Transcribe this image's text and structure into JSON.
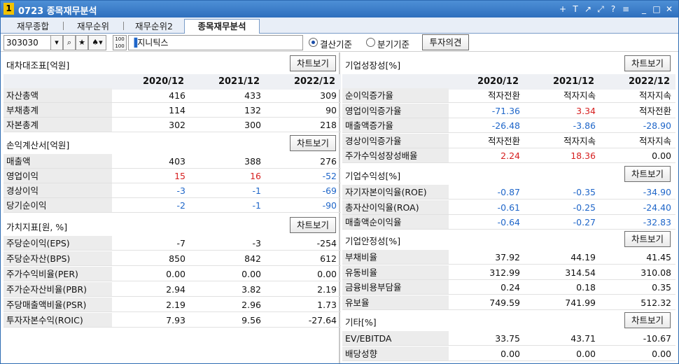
{
  "titlebar": {
    "number": "1",
    "title": "0723 종목재무분석",
    "icons": [
      "plus-icon",
      "text-icon",
      "chart-icon",
      "link-icon",
      "help-icon",
      "menu-icon",
      "minimize-icon",
      "maximize-icon",
      "close-icon"
    ],
    "glyphs": [
      "+",
      "T",
      "↗",
      "⤢",
      "?",
      "≡",
      "_",
      "□",
      "✕"
    ]
  },
  "tabs": [
    "재무종합",
    "재무순위",
    "재무순위2",
    "종목재무분석"
  ],
  "active_tab": "종목재무분석",
  "toolbar": {
    "stock_code": "303030",
    "stock_name": "지니틱스",
    "radio_annual": "결산기준",
    "radio_quarter": "분기기준",
    "selected_radio": "결산기준",
    "opinion_button": "투자의견"
  },
  "chart_button": "차트보기",
  "years": [
    "2020/12",
    "2021/12",
    "2022/12"
  ],
  "left": {
    "balance": {
      "title": "대차대조표[억원]",
      "rows": [
        {
          "label": "자산총액",
          "values": [
            "416",
            "433",
            "309"
          ],
          "colors": [
            "black",
            "black",
            "black"
          ]
        },
        {
          "label": "부채총계",
          "values": [
            "114",
            "132",
            "90"
          ],
          "colors": [
            "black",
            "black",
            "black"
          ]
        },
        {
          "label": "자본총계",
          "values": [
            "302",
            "300",
            "218"
          ],
          "colors": [
            "black",
            "black",
            "black"
          ]
        }
      ]
    },
    "income": {
      "title": "손익계산서[억원]",
      "rows": [
        {
          "label": "매출액",
          "values": [
            "403",
            "388",
            "276"
          ],
          "colors": [
            "black",
            "black",
            "black"
          ]
        },
        {
          "label": "영업이익",
          "values": [
            "15",
            "16",
            "-52"
          ],
          "colors": [
            "red",
            "red",
            "blue"
          ]
        },
        {
          "label": "경상이익",
          "values": [
            "-3",
            "-1",
            "-69"
          ],
          "colors": [
            "blue",
            "blue",
            "blue"
          ]
        },
        {
          "label": "당기순이익",
          "values": [
            "-2",
            "-1",
            "-90"
          ],
          "colors": [
            "blue",
            "blue",
            "blue"
          ]
        }
      ]
    },
    "value": {
      "title": "가치지표[원, %]",
      "rows": [
        {
          "label": "주당순이익(EPS)",
          "values": [
            "-7",
            "-3",
            "-254"
          ],
          "colors": [
            "black",
            "black",
            "black"
          ]
        },
        {
          "label": "주당순자산(BPS)",
          "values": [
            "850",
            "842",
            "612"
          ],
          "colors": [
            "black",
            "black",
            "black"
          ]
        },
        {
          "label": "주가수익비율(PER)",
          "values": [
            "0.00",
            "0.00",
            "0.00"
          ],
          "colors": [
            "black",
            "black",
            "black"
          ]
        },
        {
          "label": "주가순자산비율(PBR)",
          "values": [
            "2.94",
            "3.82",
            "2.19"
          ],
          "colors": [
            "black",
            "black",
            "black"
          ]
        },
        {
          "label": "주당매출액비율(PSR)",
          "values": [
            "2.19",
            "2.96",
            "1.73"
          ],
          "colors": [
            "black",
            "black",
            "black"
          ]
        },
        {
          "label": "투자자본수익(ROIC)",
          "values": [
            "7.93",
            "9.56",
            "-27.64"
          ],
          "colors": [
            "black",
            "black",
            "black"
          ]
        }
      ]
    }
  },
  "right": {
    "growth": {
      "title": "기업성장성[%]",
      "rows": [
        {
          "label": "순이익증가율",
          "values": [
            "적자전환",
            "적자지속",
            "적자지속"
          ],
          "colors": [
            "black",
            "black",
            "black"
          ]
        },
        {
          "label": "영업이익증가율",
          "values": [
            "-71.36",
            "3.34",
            "적자전환"
          ],
          "colors": [
            "blue",
            "red",
            "black"
          ]
        },
        {
          "label": "매출액증가율",
          "values": [
            "-26.48",
            "-3.86",
            "-28.90"
          ],
          "colors": [
            "blue",
            "blue",
            "blue"
          ]
        },
        {
          "label": "경상이익증가율",
          "values": [
            "적자전환",
            "적자지속",
            "적자지속"
          ],
          "colors": [
            "black",
            "black",
            "black"
          ]
        },
        {
          "label": "주가수익성장성배율",
          "values": [
            "2.24",
            "18.36",
            "0.00"
          ],
          "colors": [
            "red",
            "red",
            "black"
          ]
        }
      ]
    },
    "profit": {
      "title": "기업수익성[%]",
      "rows": [
        {
          "label": "자기자본이익율(ROE)",
          "values": [
            "-0.87",
            "-0.35",
            "-34.90"
          ],
          "colors": [
            "blue",
            "blue",
            "blue"
          ]
        },
        {
          "label": "총자산이익율(ROA)",
          "values": [
            "-0.61",
            "-0.25",
            "-24.40"
          ],
          "colors": [
            "blue",
            "blue",
            "blue"
          ]
        },
        {
          "label": "매출액순이익율",
          "values": [
            "-0.64",
            "-0.27",
            "-32.83"
          ],
          "colors": [
            "blue",
            "blue",
            "blue"
          ]
        }
      ]
    },
    "stability": {
      "title": "기업안정성[%]",
      "rows": [
        {
          "label": "부채비율",
          "values": [
            "37.92",
            "44.19",
            "41.45"
          ],
          "colors": [
            "black",
            "black",
            "black"
          ]
        },
        {
          "label": "유동비율",
          "values": [
            "312.99",
            "314.54",
            "310.08"
          ],
          "colors": [
            "black",
            "black",
            "black"
          ]
        },
        {
          "label": "금융비용부담율",
          "values": [
            "0.24",
            "0.18",
            "0.35"
          ],
          "colors": [
            "black",
            "black",
            "black"
          ]
        },
        {
          "label": "유보율",
          "values": [
            "749.59",
            "741.99",
            "512.32"
          ],
          "colors": [
            "black",
            "black",
            "black"
          ]
        }
      ]
    },
    "etc": {
      "title": "기타[%]",
      "rows": [
        {
          "label": "EV/EBITDA",
          "values": [
            "33.75",
            "43.71",
            "-10.67"
          ],
          "colors": [
            "black",
            "black",
            "black"
          ]
        },
        {
          "label": "배당성향",
          "values": [
            "0.00",
            "0.00",
            "0.00"
          ],
          "colors": [
            "black",
            "black",
            "black"
          ]
        }
      ]
    }
  }
}
